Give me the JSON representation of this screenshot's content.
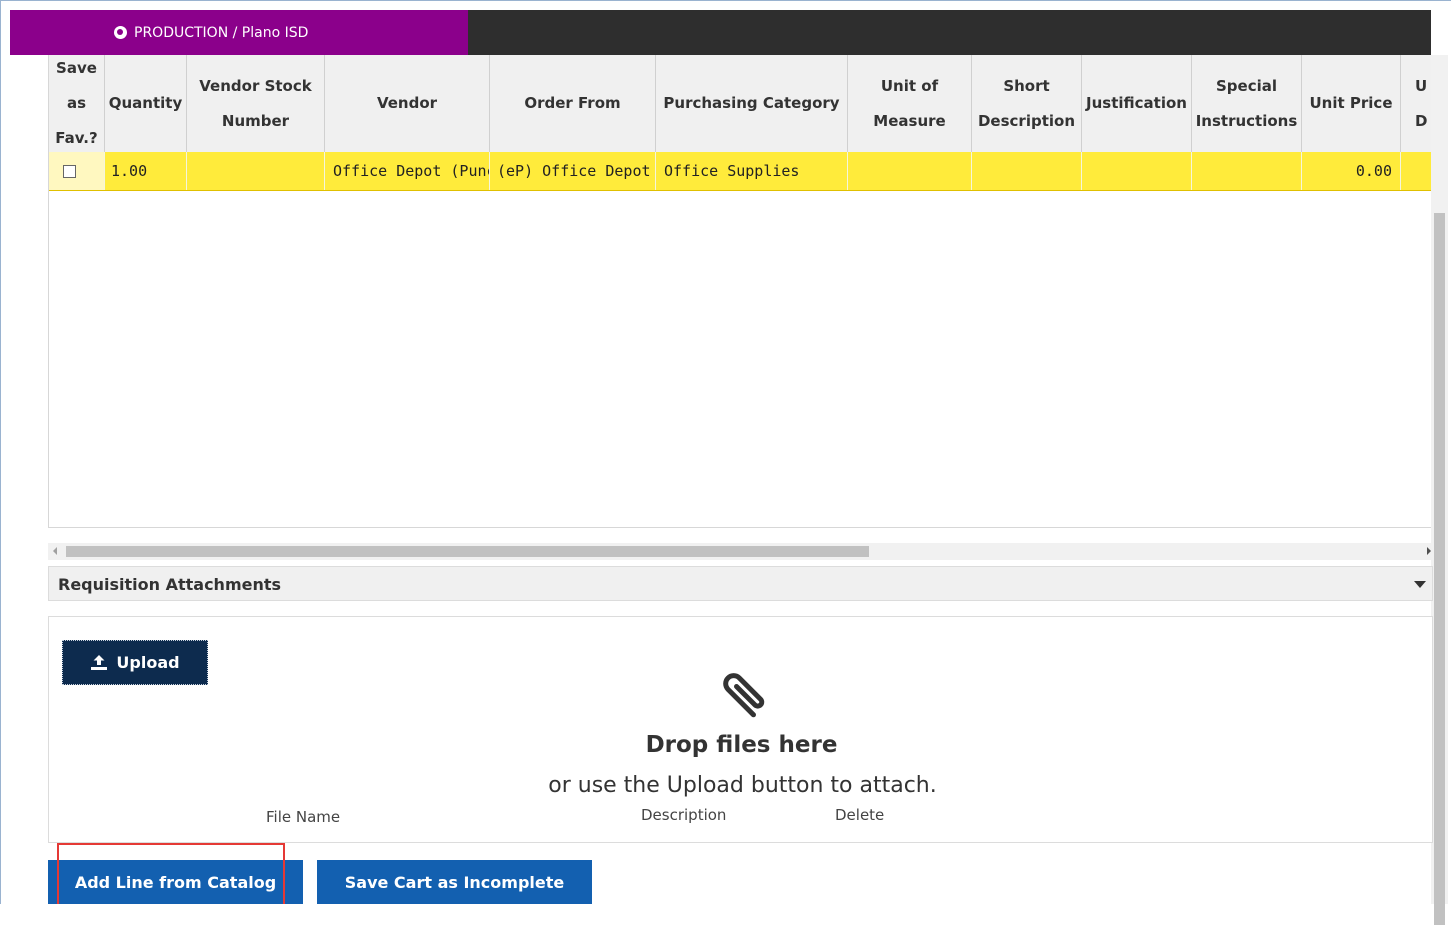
{
  "environment": {
    "label": "PRODUCTION / Plano ISD"
  },
  "grid": {
    "columns": [
      {
        "label": "Save as Fav.?"
      },
      {
        "label": "Quantity"
      },
      {
        "label": "Vendor Stock Number"
      },
      {
        "label": "Vendor"
      },
      {
        "label": "Order From"
      },
      {
        "label": "Purchasing Category"
      },
      {
        "label": "Unit of Measure"
      },
      {
        "label": "Short Description"
      },
      {
        "label": "Justification"
      },
      {
        "label": "Special Instructions"
      },
      {
        "label": "Unit Price"
      },
      {
        "label": "U D"
      }
    ],
    "rows": [
      {
        "save_fav": false,
        "quantity": "1.00",
        "vendor_stock_number": "",
        "vendor": "Office Depot (Punchc",
        "order_from": "(eP) Office Depot (Pu",
        "purchasing_category": "Office Supplies",
        "unit_of_measure": "",
        "short_description": "",
        "justification": "",
        "special_instructions": "",
        "unit_price": "0.00"
      }
    ]
  },
  "attachments": {
    "title": "Requisition Attachments",
    "upload_label": "Upload",
    "drop_title": "Drop files here",
    "drop_subtitle": "or use the Upload button to attach.",
    "columns": {
      "file_name": "File Name",
      "description": "Description",
      "delete": "Delete"
    }
  },
  "actions": {
    "add_line_from_catalog": "Add Line from Catalog",
    "save_cart_incomplete": "Save Cart as Incomplete"
  },
  "colors": {
    "banner": "#8b008b",
    "row_highlight": "#ffeb3b",
    "primary_button": "#1360b0",
    "upload_button": "#0d2b4e"
  }
}
